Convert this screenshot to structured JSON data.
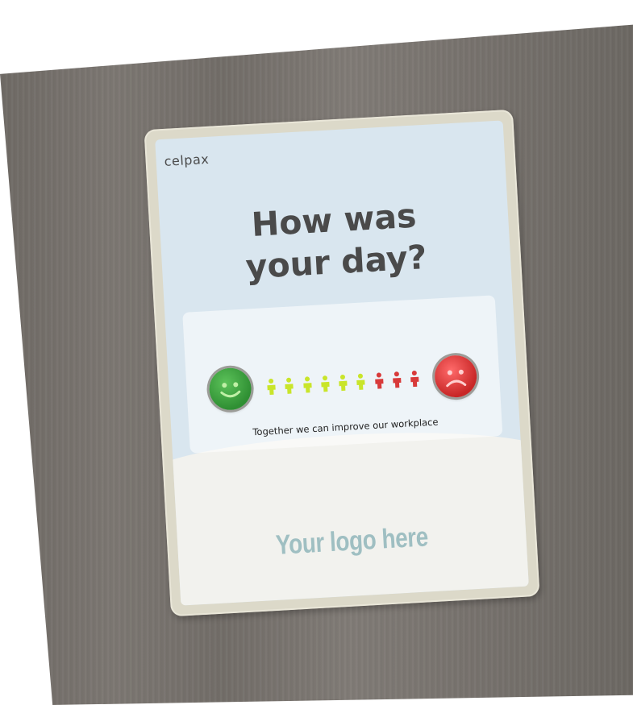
{
  "brand": "celpax",
  "headline": {
    "line1": "How was",
    "line2": "your day?"
  },
  "tagline": "Together we can improve our workplace",
  "logo_placeholder": "Your logo here",
  "buttons": [
    {
      "icon": "happy-face-icon",
      "color": "#3aa63c"
    },
    {
      "icon": "sad-face-icon",
      "color": "#e03a3a"
    }
  ],
  "indicators": [
    {
      "color": "#c9e52a"
    },
    {
      "color": "#c9e52a"
    },
    {
      "color": "#c9e52a"
    },
    {
      "color": "#c9e52a"
    },
    {
      "color": "#c9e52a"
    },
    {
      "color": "#c9e52a"
    },
    {
      "color": "#d83a3a"
    },
    {
      "color": "#d83a3a"
    },
    {
      "color": "#d83a3a"
    }
  ],
  "colors": {
    "wall": "#75706b",
    "frame": "#dcd9c9",
    "screen": "#d9e6ef",
    "text": "#4a4a4a",
    "logo": "#9fbfc2"
  }
}
